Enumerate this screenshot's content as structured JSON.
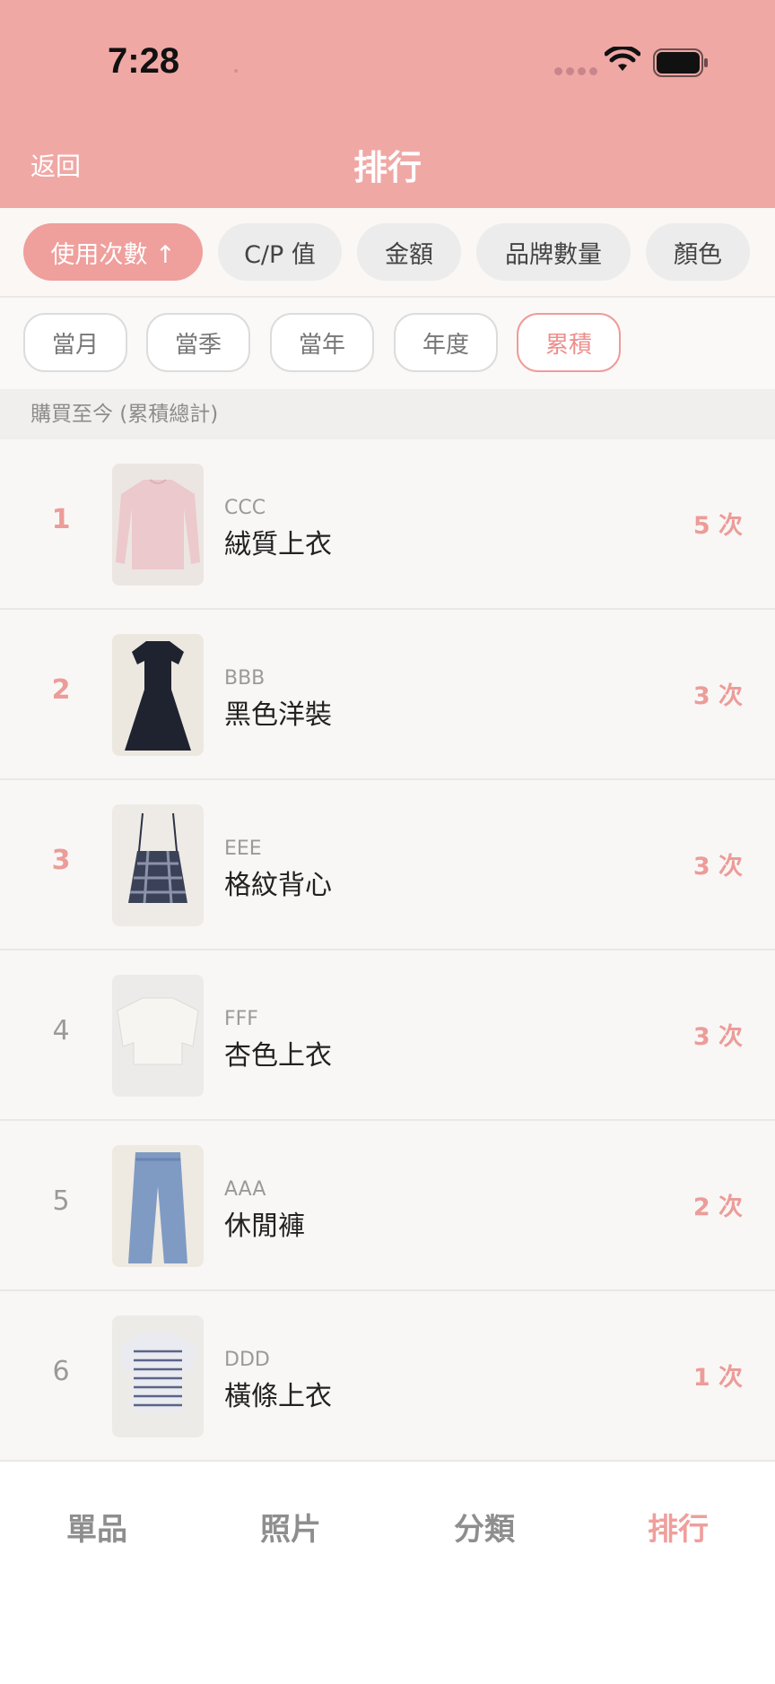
{
  "status_bar": {
    "time": "7:28"
  },
  "header": {
    "back_label": "返回",
    "title": "排行"
  },
  "metrics": [
    {
      "label": "使用次數 ↑",
      "active": true
    },
    {
      "label": "C/P 值",
      "active": false
    },
    {
      "label": "金額",
      "active": false
    },
    {
      "label": "品牌數量",
      "active": false
    },
    {
      "label": "顏色",
      "active": false
    }
  ],
  "periods": [
    {
      "label": "當月",
      "active": false
    },
    {
      "label": "當季",
      "active": false
    },
    {
      "label": "當年",
      "active": false
    },
    {
      "label": "年度",
      "active": false
    },
    {
      "label": "累積",
      "active": true
    }
  ],
  "section_title": "購買至今 (累積總計)",
  "items": [
    {
      "rank": "1",
      "brand": "CCC",
      "name": "絨質上衣",
      "count": "5 次",
      "thumb": "pink-top"
    },
    {
      "rank": "2",
      "brand": "BBB",
      "name": "黑色洋裝",
      "count": "3 次",
      "thumb": "black-dress"
    },
    {
      "rank": "3",
      "brand": "EEE",
      "name": "格紋背心",
      "count": "3 次",
      "thumb": "plaid-cami"
    },
    {
      "rank": "4",
      "brand": "FFF",
      "name": "杏色上衣",
      "count": "3 次",
      "thumb": "beige-top"
    },
    {
      "rank": "5",
      "brand": "AAA",
      "name": "休閒褲",
      "count": "2 次",
      "thumb": "jeans"
    },
    {
      "rank": "6",
      "brand": "DDD",
      "name": "橫條上衣",
      "count": "1 次",
      "thumb": "striped-tee"
    }
  ],
  "tabs": [
    {
      "label": "單品",
      "active": false
    },
    {
      "label": "照片",
      "active": false
    },
    {
      "label": "分類",
      "active": false
    },
    {
      "label": "排行",
      "active": true
    }
  ],
  "colors": {
    "accent": "#ef9f9c",
    "header": "#f0a8a5"
  }
}
